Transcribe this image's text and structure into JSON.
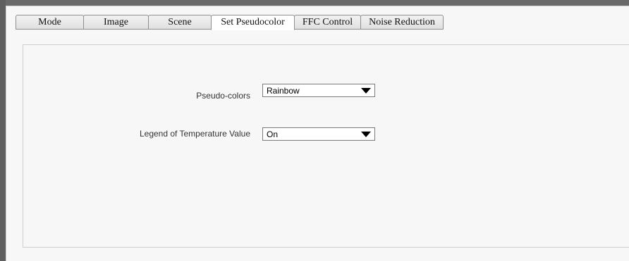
{
  "tabs": [
    {
      "label": "Mode",
      "active": false
    },
    {
      "label": "Image",
      "active": false
    },
    {
      "label": "Scene",
      "active": false
    },
    {
      "label": "Set Pseudocolor",
      "active": true
    },
    {
      "label": "FFC Control",
      "active": false
    },
    {
      "label": "Noise Reduction",
      "active": false
    }
  ],
  "form": {
    "pseudo_colors": {
      "label": "Pseudo-colors",
      "value": "Rainbow"
    },
    "legend": {
      "label": "Legend of Temperature Value",
      "value": "On"
    }
  },
  "icons": {
    "dropdown": "chevron-down-icon"
  },
  "colors": {
    "panel_bg": "#f7f7f7",
    "active_tab_bg": "#ffffff",
    "border": "#8f8f8f"
  }
}
